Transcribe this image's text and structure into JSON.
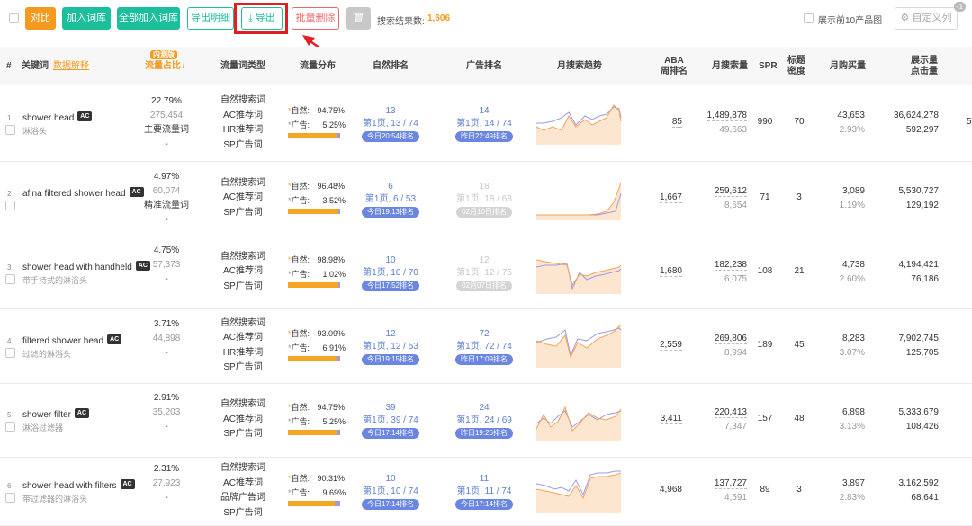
{
  "toolbar": {
    "compare": "对比",
    "add_lib": "加入词库",
    "add_all_lib": "全部加入词库",
    "export_detail": "导出明细",
    "export": "导出",
    "batch_delete": "批量删除",
    "search_result_label": "搜索结果数:",
    "search_result_count": "1,606",
    "show_top10": "展示前10产品图",
    "custom_col": "自定义列",
    "badge": "-1"
  },
  "header": {
    "idx": "#",
    "keyword": "关键词",
    "data_explain": "数据解释",
    "flow_tag": "内测版",
    "flow_share": "流量占比",
    "flow_type": "流量词类型",
    "flow_dist": "流量分布",
    "natural_rank": "自然排名",
    "ad_rank": "广告排名",
    "monthly_trend": "月搜索趋势",
    "aba1": "ABA",
    "aba2": "周排名",
    "monthly_search": "月搜索量",
    "spr": "SPR",
    "title_density1": "标题",
    "title_density2": "密度",
    "monthly_purchase": "月购买量",
    "impressions1": "展示量",
    "impressions2": "点击量"
  },
  "rows": [
    {
      "idx": "1",
      "kw": "shower head",
      "kw_zh": "淋浴头",
      "share": "22.79%",
      "share_num": "275,454",
      "share_type": "主要流量词",
      "dash": "-",
      "types": [
        "自然搜索词",
        "AC推荐词",
        "HR推荐词",
        "SP广告词"
      ],
      "nat": "94.75%",
      "ad": "5.25%",
      "nat_rank": "13",
      "nat_page": "第1页, 13 / 74",
      "nat_pill": "今日20:54排名",
      "ad_rank": "14",
      "ad_page": "第1页, 14 / 74",
      "ad_pill": "昨日22:49排名",
      "ad_dim": false,
      "aba": "85",
      "search": "1,489,878",
      "search2": "49,663",
      "spr": "990",
      "density": "70",
      "purchase": "43,653",
      "purchase_pct": "2.93%",
      "imp": "36,624,278",
      "clk": "592,297",
      "extra": "5"
    },
    {
      "idx": "2",
      "kw": "afina filtered shower head",
      "kw_zh": "",
      "share": "4.97%",
      "share_num": "60,074",
      "share_type": "精准流量词",
      "dash": "-",
      "types": [
        "自然搜索词",
        "AC推荐词",
        "SP广告词"
      ],
      "nat": "96.48%",
      "ad": "3.52%",
      "nat_rank": "6",
      "nat_page": "第1页, 6 / 53",
      "nat_pill": "今日19:13排名",
      "ad_rank": "18",
      "ad_page": "第1页, 18 / 68",
      "ad_pill": "02月10日排名",
      "ad_dim": true,
      "aba": "1,667",
      "search": "259,612",
      "search2": "8,654",
      "spr": "71",
      "density": "3",
      "purchase": "3,089",
      "purchase_pct": "1.19%",
      "imp": "5,530,727",
      "clk": "129,192",
      "extra": ""
    },
    {
      "idx": "3",
      "kw": "shower head with handheld",
      "kw_zh": "带手持式的淋浴头",
      "share": "4.75%",
      "share_num": "57,373",
      "share_type": "",
      "dash": "-",
      "types": [
        "自然搜索词",
        "AC推荐词",
        "SP广告词"
      ],
      "nat": "98.98%",
      "ad": "1.02%",
      "nat_rank": "10",
      "nat_page": "第1页, 10 / 70",
      "nat_pill": "今日17:52排名",
      "ad_rank": "12",
      "ad_page": "第1页, 12 / 75",
      "ad_pill": "02月07日排名",
      "ad_dim": true,
      "aba": "1,680",
      "search": "182,238",
      "search2": "6,075",
      "spr": "108",
      "density": "21",
      "purchase": "4,738",
      "purchase_pct": "2.60%",
      "imp": "4,194,421",
      "clk": "76,186",
      "extra": ""
    },
    {
      "idx": "4",
      "kw": "filtered shower head",
      "kw_zh": "过滤的淋浴头",
      "share": "3.71%",
      "share_num": "44,898",
      "share_type": "",
      "dash": "-",
      "types": [
        "自然搜索词",
        "AC推荐词",
        "HR推荐词",
        "SP广告词"
      ],
      "nat": "93.09%",
      "ad": "6.91%",
      "nat_rank": "12",
      "nat_page": "第1页, 12 / 53",
      "nat_pill": "今日19:15排名",
      "ad_rank": "72",
      "ad_page": "第1页, 72 / 74",
      "ad_pill": "昨日17:09排名",
      "ad_dim": false,
      "aba": "2,559",
      "search": "269,806",
      "search2": "8,994",
      "spr": "189",
      "density": "45",
      "purchase": "8,283",
      "purchase_pct": "3.07%",
      "imp": "7,902,745",
      "clk": "125,705",
      "extra": ""
    },
    {
      "idx": "5",
      "kw": "shower filter",
      "kw_zh": "淋浴过滤器",
      "share": "2.91%",
      "share_num": "35,203",
      "share_type": "",
      "dash": "-",
      "types": [
        "自然搜索词",
        "AC推荐词",
        "SP广告词"
      ],
      "nat": "94.75%",
      "ad": "5.25%",
      "nat_rank": "39",
      "nat_page": "第1页, 39 / 74",
      "nat_pill": "今日17:14排名",
      "ad_rank": "24",
      "ad_page": "第1页, 24 / 69",
      "ad_pill": "昨日19:26排名",
      "ad_dim": false,
      "aba": "3,411",
      "search": "220,413",
      "search2": "7,347",
      "spr": "157",
      "density": "48",
      "purchase": "6,898",
      "purchase_pct": "3.13%",
      "imp": "5,333,679",
      "clk": "108,426",
      "extra": ""
    },
    {
      "idx": "6",
      "kw": "shower head with filters",
      "kw_zh": "带过滤器的淋浴头",
      "share": "2.31%",
      "share_num": "27,923",
      "share_type": "",
      "dash": "-",
      "types": [
        "自然搜索词",
        "AC推荐词",
        "品牌广告词",
        "SP广告词"
      ],
      "nat": "90.31%",
      "ad": "9.69%",
      "nat_rank": "10",
      "nat_page": "第1页, 10 / 74",
      "nat_pill": "今日17:14排名",
      "ad_rank": "11",
      "ad_page": "第1页, 11 / 74",
      "ad_pill": "今日17:14排名",
      "ad_dim": false,
      "aba": "4,968",
      "search": "137,727",
      "search2": "4,591",
      "spr": "89",
      "density": "3",
      "purchase": "3,897",
      "purchase_pct": "2.83%",
      "imp": "3,162,592",
      "clk": "68,641",
      "extra": ""
    }
  ],
  "colors": {
    "accent_orange": "#f39a1f",
    "teal": "#1cbf9c",
    "red": "#e02020",
    "rank_blue": "#5b7fd0",
    "spark_fill": "#fde6cf",
    "spark_orange": "#f5a35a",
    "spark_purple": "#9b9be6"
  }
}
